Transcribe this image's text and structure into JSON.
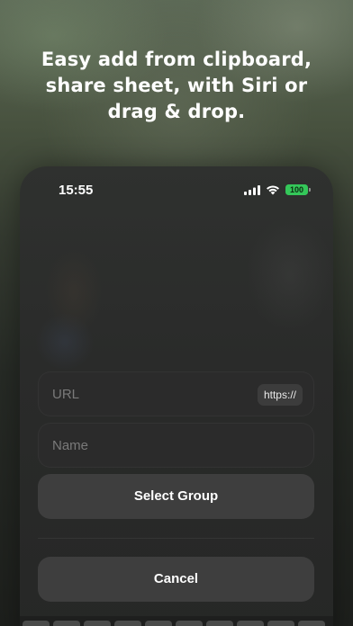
{
  "headline": "Easy add from clipboard,\nshare sheet, with Siri or\ndrag & drop.",
  "status_bar": {
    "time": "15:55",
    "battery": "100",
    "signal_icon": "cellular-signal-icon",
    "wifi_icon": "wifi-icon"
  },
  "form": {
    "url_placeholder": "URL",
    "url_prefix_chip": "https://",
    "name_placeholder": "Name",
    "select_group_label": "Select Group",
    "cancel_label": "Cancel"
  },
  "colors": {
    "battery_green": "#34c759",
    "field_bg": "#2b2b2b",
    "button_bg": "#3e3e3e"
  }
}
